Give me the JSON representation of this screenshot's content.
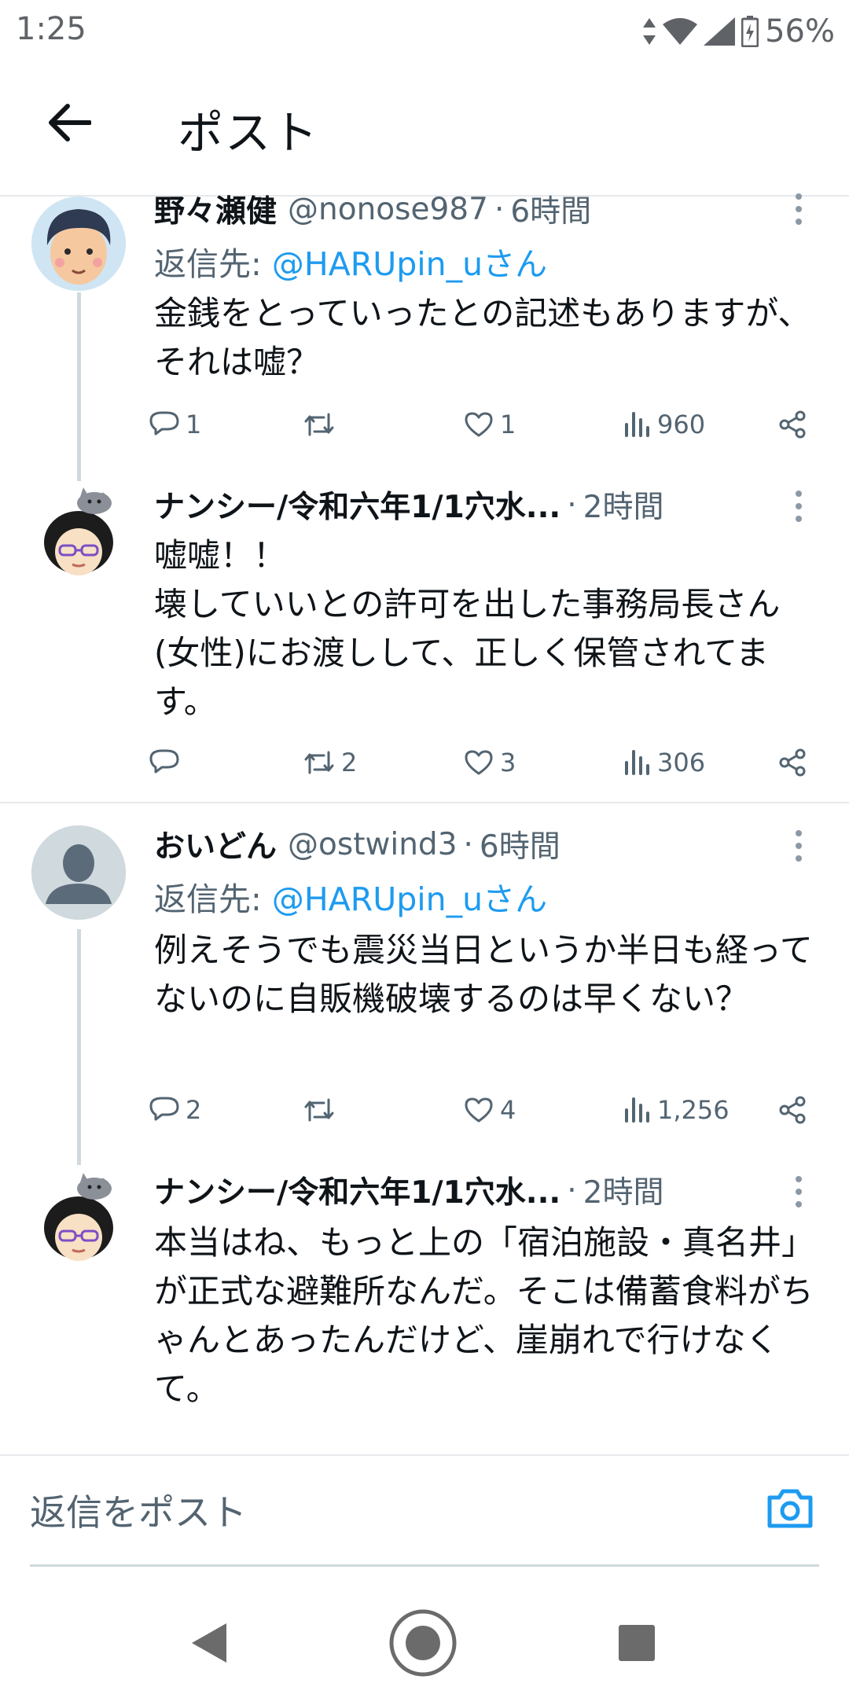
{
  "status_bar": {
    "time": "1:25",
    "battery": "56%"
  },
  "header": {
    "title": "ポスト"
  },
  "tweets": [
    {
      "name": "野々瀬健",
      "handle": "@nonose987",
      "time": "6時間",
      "reply_prefix": "返信先: ",
      "reply_mention": "@HARUpin_uさん",
      "text": "金銭をとっていったとの記述もありますが、それは嘘？",
      "replies": "1",
      "retweets": "",
      "likes": "1",
      "views": "960"
    },
    {
      "name": "ナンシー/令和六年1/1穴水...",
      "handle": "",
      "time": "2時間",
      "text": "嘘嘘！！\n壊していいとの許可を出した事務局長さん(女性)にお渡しして、正しく保管されてます。",
      "replies": "",
      "retweets": "2",
      "likes": "3",
      "views": "306"
    },
    {
      "name": "おいどん",
      "handle": "@ostwind3",
      "time": "6時間",
      "reply_prefix": "返信先: ",
      "reply_mention": "@HARUpin_uさん",
      "text": "例えそうでも震災当日というか半日も経ってないのに自販機破壊するのは早くない？",
      "replies": "2",
      "retweets": "",
      "likes": "4",
      "views": "1,256"
    },
    {
      "name": "ナンシー/令和六年1/1穴水...",
      "handle": "",
      "time": "2時間",
      "text": "本当はね、もっと上の「宿泊施設・真名井」が正式な避難所なんだ。そこは備蓄食料がちゃんとあったんだけど、崖崩れで行けなくて。"
    }
  ],
  "separator": "·",
  "composer": {
    "placeholder": "返信をポスト"
  },
  "colors": {
    "accent": "#1d9bf0",
    "secondary_text": "#536471",
    "divider": "#e6e8eb"
  }
}
